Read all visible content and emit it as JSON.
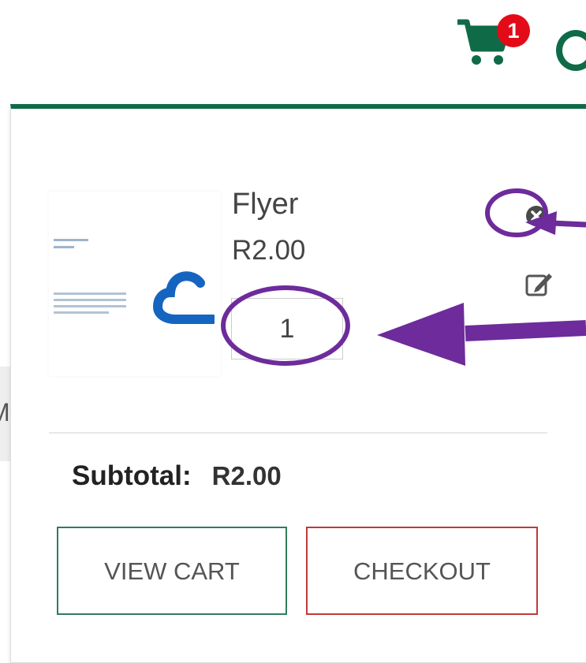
{
  "header": {
    "cart_badge_count": "1",
    "cart_icon": "shopping-cart-icon"
  },
  "mini_cart": {
    "item": {
      "name": "Flyer",
      "price": "R2.00",
      "quantity": "1",
      "thumbnail": "product-thumbnail"
    },
    "subtotal_label": "Subtotal:",
    "subtotal_value": "R2.00",
    "buttons": {
      "view_cart": "VIEW CART",
      "checkout": "CHECKOUT"
    },
    "icons": {
      "remove": "remove-circle-icon",
      "edit": "edit-icon"
    }
  },
  "background": {
    "partial_letter": "M"
  },
  "colors": {
    "brand_green": "#0f6b47",
    "badge_red": "#e30b17",
    "view_cart_border": "#2f7d5c",
    "checkout_border": "#c0393b",
    "annotation_purple": "#6d2b9b"
  }
}
